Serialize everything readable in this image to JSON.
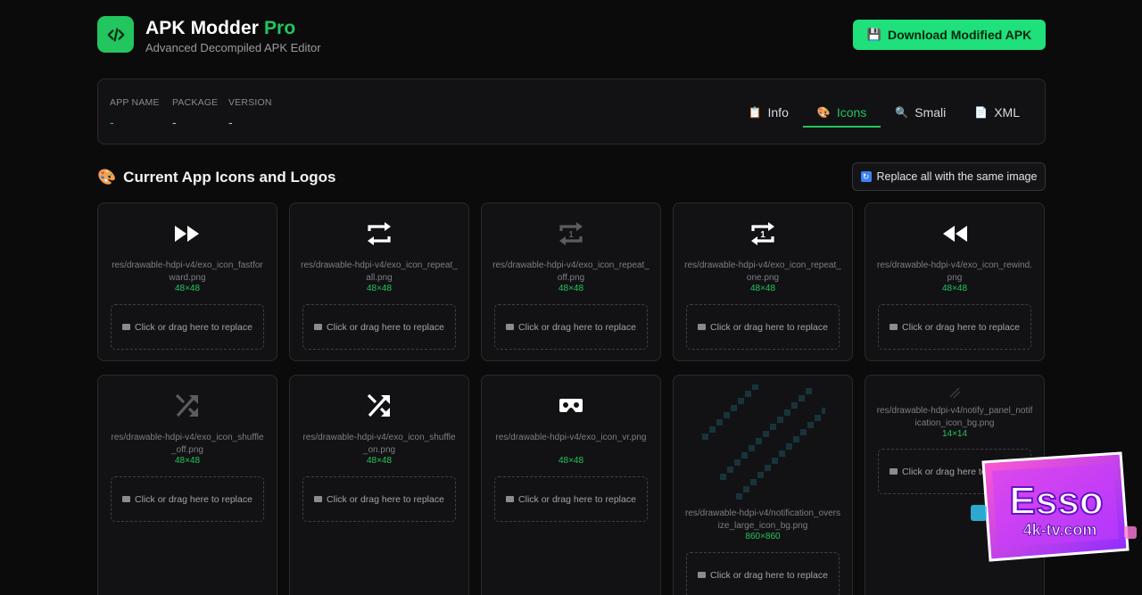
{
  "header": {
    "title_main": "APK Modder",
    "title_accent": "Pro",
    "subtitle": "Advanced Decompiled APK Editor",
    "download_label": "Download Modified APK",
    "download_icon": "floppy-disk-icon"
  },
  "info": {
    "app_name_label": "APP NAME",
    "app_name_value": "-",
    "package_label": "PACKAGE",
    "package_value": "-",
    "version_label": "VERSION",
    "version_value": "-"
  },
  "tabs": [
    {
      "label": "Info",
      "icon": "clipboard-icon",
      "glyph": "📋",
      "active": false
    },
    {
      "label": "Icons",
      "icon": "palette-icon",
      "glyph": "🎨",
      "active": true
    },
    {
      "label": "Smali",
      "icon": "magnifier-icon",
      "glyph": "🔍",
      "active": false
    },
    {
      "label": "XML",
      "icon": "document-icon",
      "glyph": "📄",
      "active": false
    }
  ],
  "section": {
    "title": "Current App Icons and Logos",
    "replace_all_label": "Replace all with the same image"
  },
  "dropzone_label": "Click or drag here to replace",
  "icons": [
    {
      "path": "res/drawable-hdpi-v4/exo_icon_fastforward.png",
      "size": "48×48",
      "kind": "fast-forward"
    },
    {
      "path": "res/drawable-hdpi-v4/exo_icon_repeat_all.png",
      "size": "48×48",
      "kind": "repeat"
    },
    {
      "path": "res/drawable-hdpi-v4/exo_icon_repeat_off.png",
      "size": "48×48",
      "kind": "repeat-one-dim"
    },
    {
      "path": "res/drawable-hdpi-v4/exo_icon_repeat_one.png",
      "size": "48×48",
      "kind": "repeat-one"
    },
    {
      "path": "res/drawable-hdpi-v4/exo_icon_rewind.png",
      "size": "48×48",
      "kind": "rewind"
    },
    {
      "path": "res/drawable-hdpi-v4/exo_icon_shuffle_off.png",
      "size": "48×48",
      "kind": "shuffle-dim"
    },
    {
      "path": "res/drawable-hdpi-v4/exo_icon_shuffle_on.png",
      "size": "48×48",
      "kind": "shuffle"
    },
    {
      "path": "res/drawable-hdpi-v4/exo_icon_vr.png",
      "size": "48×48",
      "kind": "vr"
    },
    {
      "path": "res/drawable-hdpi-v4/notification_oversize_large_icon_bg.png",
      "size": "860×860",
      "kind": "pattern"
    },
    {
      "path": "res/drawable-hdpi-v4/notify_panel_notification_icon_bg.png",
      "size": "14×14",
      "kind": "small-pattern"
    }
  ],
  "watermark": {
    "line1": "Esso",
    "line2": "4k-tv.com"
  },
  "colors": {
    "accent": "#22c55e",
    "button": "#1fe07a",
    "bg": "#0b0b0c",
    "card": "#121214"
  }
}
